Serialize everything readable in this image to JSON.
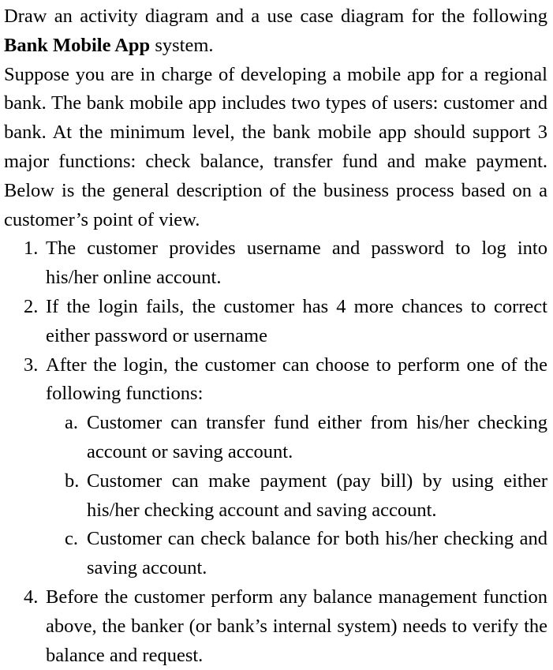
{
  "document": {
    "kind": "assignment-prompt",
    "text_color": "#000000",
    "background_color": "#ffffff",
    "paragraphs": [
      {
        "id": "p1",
        "before_bold": "Draw an activity diagram and a use case diagram for the following ",
        "bold": "Bank Mobile App",
        "after_bold": " system."
      },
      {
        "id": "p2",
        "text": "Suppose you are in charge of developing a mobile app for a regional bank. The bank mobile app includes two types of users: customer and bank. At the minimum level, the bank mobile app should support 3 major functions: check balance, transfer fund and make payment. Below is the general description of the business process based on a customer’s point of view."
      }
    ],
    "list": {
      "items": [
        {
          "marker": "1.",
          "text": "The customer provides username and password to log into his/her online account.",
          "sub_items": []
        },
        {
          "marker": "2.",
          "text": "If the login fails, the customer has 4 more chances to correct either password or username",
          "sub_items": []
        },
        {
          "marker": "3.",
          "text": "After the login, the customer can choose to perform one of the following functions:",
          "sub_items": [
            {
              "marker": "a.",
              "text": "Customer can transfer fund either from his/her checking account or saving account."
            },
            {
              "marker": "b.",
              "text": "Customer can make payment (pay bill) by using either his/her checking account and saving account."
            },
            {
              "marker": "c.",
              "text": "Customer can check balance for both his/her checking and saving account."
            }
          ]
        },
        {
          "marker": "4.",
          "text": "Before the customer perform any balance management function above, the banker (or bank’s internal system) needs to verify the balance and request.",
          "sub_items": []
        }
      ]
    }
  }
}
